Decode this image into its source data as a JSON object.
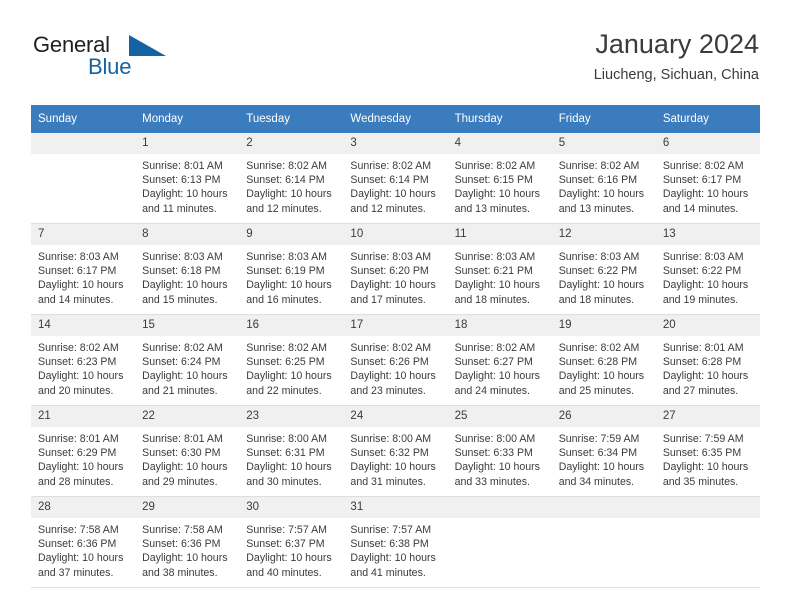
{
  "brand": {
    "name_part1": "General",
    "name_part2": "Blue",
    "logo_icon": "triangle-icon"
  },
  "header": {
    "title": "January 2024",
    "subtitle": "Liucheng, Sichuan, China"
  },
  "theme": {
    "header_bar": "#3a7cbe",
    "brand_blue": "#1464a5",
    "day_number_bg": "#f0f0f0",
    "text": "#3b3b3b",
    "grid_line": "#dedede"
  },
  "calendar": {
    "weekday_headers": [
      "Sunday",
      "Monday",
      "Tuesday",
      "Wednesday",
      "Thursday",
      "Friday",
      "Saturday"
    ],
    "weeks": [
      [
        {
          "day": "",
          "empty": true,
          "sunrise": "",
          "sunset": "",
          "daylight1": "",
          "daylight2": ""
        },
        {
          "day": "1",
          "empty": false,
          "sunrise": "Sunrise: 8:01 AM",
          "sunset": "Sunset: 6:13 PM",
          "daylight1": "Daylight: 10 hours",
          "daylight2": "and 11 minutes."
        },
        {
          "day": "2",
          "empty": false,
          "sunrise": "Sunrise: 8:02 AM",
          "sunset": "Sunset: 6:14 PM",
          "daylight1": "Daylight: 10 hours",
          "daylight2": "and 12 minutes."
        },
        {
          "day": "3",
          "empty": false,
          "sunrise": "Sunrise: 8:02 AM",
          "sunset": "Sunset: 6:14 PM",
          "daylight1": "Daylight: 10 hours",
          "daylight2": "and 12 minutes."
        },
        {
          "day": "4",
          "empty": false,
          "sunrise": "Sunrise: 8:02 AM",
          "sunset": "Sunset: 6:15 PM",
          "daylight1": "Daylight: 10 hours",
          "daylight2": "and 13 minutes."
        },
        {
          "day": "5",
          "empty": false,
          "sunrise": "Sunrise: 8:02 AM",
          "sunset": "Sunset: 6:16 PM",
          "daylight1": "Daylight: 10 hours",
          "daylight2": "and 13 minutes."
        },
        {
          "day": "6",
          "empty": false,
          "sunrise": "Sunrise: 8:02 AM",
          "sunset": "Sunset: 6:17 PM",
          "daylight1": "Daylight: 10 hours",
          "daylight2": "and 14 minutes."
        }
      ],
      [
        {
          "day": "7",
          "empty": false,
          "sunrise": "Sunrise: 8:03 AM",
          "sunset": "Sunset: 6:17 PM",
          "daylight1": "Daylight: 10 hours",
          "daylight2": "and 14 minutes."
        },
        {
          "day": "8",
          "empty": false,
          "sunrise": "Sunrise: 8:03 AM",
          "sunset": "Sunset: 6:18 PM",
          "daylight1": "Daylight: 10 hours",
          "daylight2": "and 15 minutes."
        },
        {
          "day": "9",
          "empty": false,
          "sunrise": "Sunrise: 8:03 AM",
          "sunset": "Sunset: 6:19 PM",
          "daylight1": "Daylight: 10 hours",
          "daylight2": "and 16 minutes."
        },
        {
          "day": "10",
          "empty": false,
          "sunrise": "Sunrise: 8:03 AM",
          "sunset": "Sunset: 6:20 PM",
          "daylight1": "Daylight: 10 hours",
          "daylight2": "and 17 minutes."
        },
        {
          "day": "11",
          "empty": false,
          "sunrise": "Sunrise: 8:03 AM",
          "sunset": "Sunset: 6:21 PM",
          "daylight1": "Daylight: 10 hours",
          "daylight2": "and 18 minutes."
        },
        {
          "day": "12",
          "empty": false,
          "sunrise": "Sunrise: 8:03 AM",
          "sunset": "Sunset: 6:22 PM",
          "daylight1": "Daylight: 10 hours",
          "daylight2": "and 18 minutes."
        },
        {
          "day": "13",
          "empty": false,
          "sunrise": "Sunrise: 8:03 AM",
          "sunset": "Sunset: 6:22 PM",
          "daylight1": "Daylight: 10 hours",
          "daylight2": "and 19 minutes."
        }
      ],
      [
        {
          "day": "14",
          "empty": false,
          "sunrise": "Sunrise: 8:02 AM",
          "sunset": "Sunset: 6:23 PM",
          "daylight1": "Daylight: 10 hours",
          "daylight2": "and 20 minutes."
        },
        {
          "day": "15",
          "empty": false,
          "sunrise": "Sunrise: 8:02 AM",
          "sunset": "Sunset: 6:24 PM",
          "daylight1": "Daylight: 10 hours",
          "daylight2": "and 21 minutes."
        },
        {
          "day": "16",
          "empty": false,
          "sunrise": "Sunrise: 8:02 AM",
          "sunset": "Sunset: 6:25 PM",
          "daylight1": "Daylight: 10 hours",
          "daylight2": "and 22 minutes."
        },
        {
          "day": "17",
          "empty": false,
          "sunrise": "Sunrise: 8:02 AM",
          "sunset": "Sunset: 6:26 PM",
          "daylight1": "Daylight: 10 hours",
          "daylight2": "and 23 minutes."
        },
        {
          "day": "18",
          "empty": false,
          "sunrise": "Sunrise: 8:02 AM",
          "sunset": "Sunset: 6:27 PM",
          "daylight1": "Daylight: 10 hours",
          "daylight2": "and 24 minutes."
        },
        {
          "day": "19",
          "empty": false,
          "sunrise": "Sunrise: 8:02 AM",
          "sunset": "Sunset: 6:28 PM",
          "daylight1": "Daylight: 10 hours",
          "daylight2": "and 25 minutes."
        },
        {
          "day": "20",
          "empty": false,
          "sunrise": "Sunrise: 8:01 AM",
          "sunset": "Sunset: 6:28 PM",
          "daylight1": "Daylight: 10 hours",
          "daylight2": "and 27 minutes."
        }
      ],
      [
        {
          "day": "21",
          "empty": false,
          "sunrise": "Sunrise: 8:01 AM",
          "sunset": "Sunset: 6:29 PM",
          "daylight1": "Daylight: 10 hours",
          "daylight2": "and 28 minutes."
        },
        {
          "day": "22",
          "empty": false,
          "sunrise": "Sunrise: 8:01 AM",
          "sunset": "Sunset: 6:30 PM",
          "daylight1": "Daylight: 10 hours",
          "daylight2": "and 29 minutes."
        },
        {
          "day": "23",
          "empty": false,
          "sunrise": "Sunrise: 8:00 AM",
          "sunset": "Sunset: 6:31 PM",
          "daylight1": "Daylight: 10 hours",
          "daylight2": "and 30 minutes."
        },
        {
          "day": "24",
          "empty": false,
          "sunrise": "Sunrise: 8:00 AM",
          "sunset": "Sunset: 6:32 PM",
          "daylight1": "Daylight: 10 hours",
          "daylight2": "and 31 minutes."
        },
        {
          "day": "25",
          "empty": false,
          "sunrise": "Sunrise: 8:00 AM",
          "sunset": "Sunset: 6:33 PM",
          "daylight1": "Daylight: 10 hours",
          "daylight2": "and 33 minutes."
        },
        {
          "day": "26",
          "empty": false,
          "sunrise": "Sunrise: 7:59 AM",
          "sunset": "Sunset: 6:34 PM",
          "daylight1": "Daylight: 10 hours",
          "daylight2": "and 34 minutes."
        },
        {
          "day": "27",
          "empty": false,
          "sunrise": "Sunrise: 7:59 AM",
          "sunset": "Sunset: 6:35 PM",
          "daylight1": "Daylight: 10 hours",
          "daylight2": "and 35 minutes."
        }
      ],
      [
        {
          "day": "28",
          "empty": false,
          "sunrise": "Sunrise: 7:58 AM",
          "sunset": "Sunset: 6:36 PM",
          "daylight1": "Daylight: 10 hours",
          "daylight2": "and 37 minutes."
        },
        {
          "day": "29",
          "empty": false,
          "sunrise": "Sunrise: 7:58 AM",
          "sunset": "Sunset: 6:36 PM",
          "daylight1": "Daylight: 10 hours",
          "daylight2": "and 38 minutes."
        },
        {
          "day": "30",
          "empty": false,
          "sunrise": "Sunrise: 7:57 AM",
          "sunset": "Sunset: 6:37 PM",
          "daylight1": "Daylight: 10 hours",
          "daylight2": "and 40 minutes."
        },
        {
          "day": "31",
          "empty": false,
          "sunrise": "Sunrise: 7:57 AM",
          "sunset": "Sunset: 6:38 PM",
          "daylight1": "Daylight: 10 hours",
          "daylight2": "and 41 minutes."
        },
        {
          "day": "",
          "empty": true,
          "sunrise": "",
          "sunset": "",
          "daylight1": "",
          "daylight2": ""
        },
        {
          "day": "",
          "empty": true,
          "sunrise": "",
          "sunset": "",
          "daylight1": "",
          "daylight2": ""
        },
        {
          "day": "",
          "empty": true,
          "sunrise": "",
          "sunset": "",
          "daylight1": "",
          "daylight2": ""
        }
      ]
    ]
  }
}
